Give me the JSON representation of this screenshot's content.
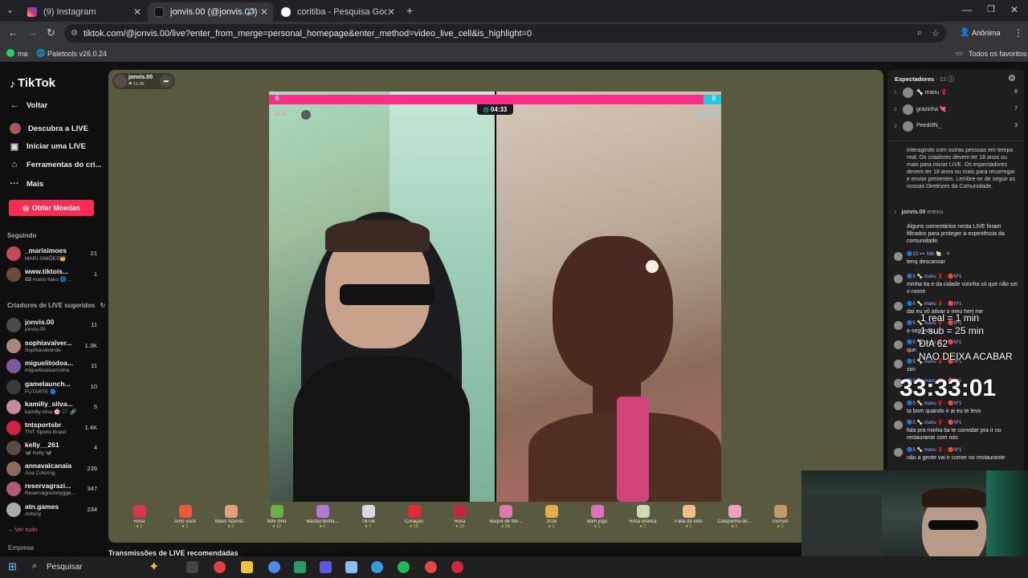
{
  "browser": {
    "tabs": [
      {
        "title": "(9) Instagram",
        "color": "#d6249f"
      },
      {
        "title": "jonvis.00 (@jonvis.00) com",
        "color": "#111111"
      },
      {
        "title": "coritiba - Pesquisa Google",
        "color": "#4285f4"
      }
    ],
    "url": "tiktok.com/@jonvis.00/live?enter_from_merge=personal_homepage&enter_method=video_live_cell&is_highlight=0",
    "profile": "Anônima",
    "bookmarks": {
      "item1": "ma",
      "item2": "Paletools v26.0.24",
      "all": "Todos os favoritos"
    }
  },
  "sidebar": {
    "logo": "TikTok",
    "back": "Voltar",
    "nav": [
      "Descubra a LIVE",
      "Iniciar uma LIVE",
      "Ferramentas do cri...",
      "Mais"
    ],
    "coins_button": "Obter Moedas",
    "following_title": "Seguindo",
    "following": [
      {
        "name": "_marisimoes",
        "sub": "MARI SIMÕES👑",
        "count": "21",
        "color": "#c04a5e"
      },
      {
        "name": "www.tiktois...",
        "sub": "🎟 mano tiako 🌐 ...",
        "count": "1",
        "color": "#6b4a3c"
      }
    ],
    "suggested_title": "Criadores de LIVE sugeridos",
    "suggested": [
      {
        "name": "jonvis.00",
        "sub": "jonvis.00",
        "count": "11",
        "color": "#4a4a4a"
      },
      {
        "name": "sophiavalver...",
        "sub": "Sophiavalverde",
        "count": "1.3K",
        "color": "#a98a7a"
      },
      {
        "name": "miguelitodoa...",
        "sub": "miguelitodoarrocha",
        "count": "11",
        "color": "#7a5a9a"
      },
      {
        "name": "gamelaunch...",
        "sub": "FUTARTE 🔵",
        "count": "10",
        "color": "#3a3a3a"
      },
      {
        "name": "kamilly_silva...",
        "sub": "kamilly.silva 🌸 🏳 🔗",
        "count": "5",
        "color": "#c48aa0"
      },
      {
        "name": "tntsportsbr",
        "sub": "TNT Sports Brasil",
        "count": "1.4K",
        "color": "#d4214a"
      },
      {
        "name": "kelly__261",
        "sub": "🦋 Kelly 🦋",
        "count": "4",
        "color": "#5a4a4a"
      },
      {
        "name": "annavalcanaia",
        "sub": "Ana Coloring",
        "count": "239",
        "color": "#8a6a5a"
      },
      {
        "name": "reservagrazi...",
        "sub": "Reservagrazielygge...",
        "count": "347",
        "color": "#b05a7a"
      },
      {
        "name": "atn.games",
        "sub": "Antony",
        "count": "234",
        "color": "#aaaaaa"
      }
    ],
    "see_all": "Ver tudo",
    "company": "Empresa"
  },
  "stream": {
    "host": "jonvis.00",
    "host_sub": "❤ 11.0K",
    "score_left": "6",
    "score_right": "0",
    "timer": "04:33"
  },
  "gifts": [
    {
      "name": "Rosa",
      "price": "1",
      "color": "#d23a4a"
    },
    {
      "name": "Amo você",
      "price": "1",
      "color": "#e85a3a"
    },
    {
      "name": "Mãos fazend...",
      "price": "5",
      "color": "#e0a07a"
    },
    {
      "name": "Mini dino",
      "price": "10",
      "color": "#6ab04a"
    },
    {
      "name": "Bastão brilha...",
      "price": "1",
      "color": "#b07ad0"
    },
    {
      "name": "TikTok",
      "price": "1",
      "color": "#d8d8e8"
    },
    {
      "name": "Coração",
      "price": "10",
      "color": "#e02a3a"
    },
    {
      "name": "Rosa",
      "price": "10",
      "color": "#c02a3a"
    },
    {
      "name": "Buquê de flor...",
      "price": "30",
      "color": "#e07ab0"
    },
    {
      "name": "2026",
      "price": "1",
      "color": "#e0b04a"
    },
    {
      "name": "Bom jogo",
      "price": "1",
      "color": "#e070c0"
    },
    {
      "name": "Rosa branca",
      "price": "1",
      "color": "#d0d8b0"
    },
    {
      "name": "Fatia de bolo",
      "price": "1",
      "color": "#f0c08a"
    },
    {
      "name": "Casquinha de...",
      "price": "1",
      "color": "#f0a0c0"
    },
    {
      "name": "Incrível",
      "price": "1",
      "color": "#c09a6a"
    }
  ],
  "chat": {
    "viewers_title": "Espectadores",
    "viewers_count": "· 12",
    "top_viewers": [
      {
        "rank": "1",
        "name": "🦴 manu 🌹",
        "count": "8"
      },
      {
        "rank": "2",
        "name": "grazinha 💘",
        "count": "7"
      },
      {
        "rank": "3",
        "name": "PeedrilN_",
        "count": "3"
      }
    ],
    "system_notice": "interagindo com outras pessoas em tempo real. Os criadores devem ter 18 anos ou mais para iniciar LIVE. Os espectadores devem ter 18 anos ou mais para recarregar e enviar presentes. Lembre-se de seguir as nossas Diretrizes da Comunidade.",
    "joined_user": "jonvis.00",
    "joined_text": "entrou",
    "filter_notice": "Alguns comentários nesta LIVE foram filtrados para proteger a experiência da comunidade.",
    "messages": [
      {
        "head": "🔵23 👓 Mih 🐚 · ⚘",
        "text": "tenq descansar"
      },
      {
        "head": "🔵5 🦴 manu 🌹 · 🔴Nº1",
        "text": "minha tia e da cidade vizinha só que não sei o nome"
      },
      {
        "head": "🔵5 🦴 manu 🌹 · 🔴Nº1",
        "text": "daí eu vô ativar o meu hert me"
      },
      {
        "head": "🔵5 🦴 manu 🌹 · 🔴Nº1",
        "text": "a segunda..."
      },
      {
        "head": "🔵5 🦴 manu 🌹 · 🔴Nº1",
        "text": "que"
      },
      {
        "head": "🔵5 🦴 manu 🌹 · 🔴Nº1",
        "text": "sim"
      },
      {
        "head": "🔵5 🦴 manu 🌹 · 🔴Nº1",
        "text": ""
      },
      {
        "head": "🔵5 🦴 manu 🌹 · 🔴Nº1",
        "text": "ta bom quando ir ai eu te levo"
      },
      {
        "head": "🔵5 🦴 manu 🌹 · 🔴Nº1",
        "text": "fala pra minha tia te convidar pra ir no restaurante com nós"
      },
      {
        "head": "🔵5 🦴 manu 🌹 · 🔴Nº1",
        "text": "não a gente vai ir comer no restaurante"
      }
    ]
  },
  "overlay": {
    "line1": "1 real = 1 min",
    "line2": "1 sub = 25 min",
    "line3": "DIA 62",
    "line4": "NAO DEIXA ACABAR",
    "countdown": "33:33:01"
  },
  "recommended": "Transmissões de LIVE recomendadas",
  "taskbar": {
    "search": "Pesquisar"
  }
}
